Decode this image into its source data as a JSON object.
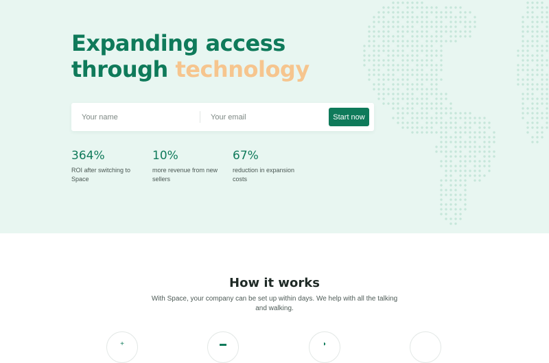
{
  "hero": {
    "headline_line1": "Expanding access",
    "headline_line2_prefix": "through ",
    "headline_line2_accent": "technology"
  },
  "signup": {
    "name_placeholder": "Your name",
    "email_placeholder": "Your email",
    "start_label": "Start now"
  },
  "stats": [
    {
      "value": "364%",
      "label": "ROI after switching to Space"
    },
    {
      "value": "10%",
      "label": "more revenue from new sellers"
    },
    {
      "value": "67%",
      "label": "reduction in expansion costs"
    }
  ],
  "how_it_works": {
    "title": "How it works",
    "subtitle": "With Space, your company can be set up within days. We help with all the talking and walking."
  },
  "steps": [
    {
      "icon": "plus-icon"
    },
    {
      "icon": "document-icon"
    },
    {
      "icon": "leaf-icon"
    },
    {
      "icon": "globe-icon"
    }
  ],
  "colors": {
    "brand_green": "#0f7a5a",
    "accent_peach": "#f6c58e",
    "hero_background": "#e8f6f1"
  }
}
